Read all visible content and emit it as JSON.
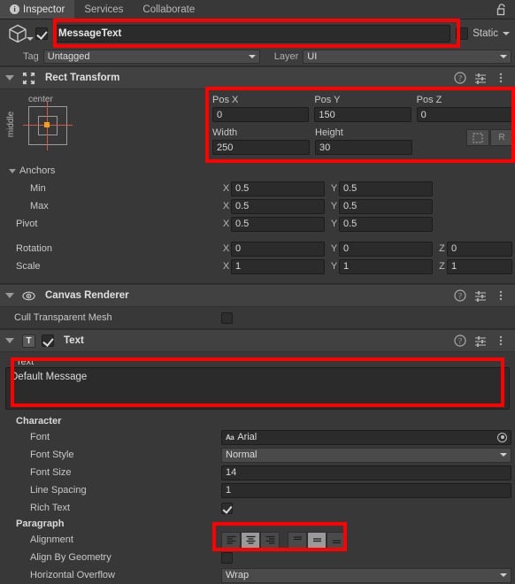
{
  "window": {
    "tabs": [
      {
        "label": "Inspector",
        "icon": "info-icon",
        "active": true
      },
      {
        "label": "Services",
        "icon": null,
        "active": false
      },
      {
        "label": "Collaborate",
        "icon": null,
        "active": false
      }
    ],
    "lock_icon": "lock-open-icon"
  },
  "gameobject": {
    "icon": "cube-icon",
    "enabled": true,
    "name": "MessageText",
    "static_label": "Static",
    "static_enabled": false,
    "tag_label": "Tag",
    "tag_value": "Untagged",
    "layer_label": "Layer",
    "layer_value": "UI"
  },
  "rect_transform": {
    "title": "Rect Transform",
    "icon": "rect-transform-icon",
    "anchor_preset": {
      "horizontal": "center",
      "vertical": "middle"
    },
    "pos_x_label": "Pos X",
    "pos_x": "0",
    "pos_y_label": "Pos Y",
    "pos_y": "150",
    "pos_z_label": "Pos Z",
    "pos_z": "0",
    "width_label": "Width",
    "width": "250",
    "height_label": "Height",
    "height": "30",
    "blueprint_icon": "blueprint-mode-icon",
    "raw_label": "R",
    "anchors_label": "Anchors",
    "min_label": "Min",
    "min_x": "0.5",
    "min_y": "0.5",
    "max_label": "Max",
    "max_x": "0.5",
    "max_y": "0.5",
    "pivot_label": "Pivot",
    "pivot_x": "0.5",
    "pivot_y": "0.5",
    "rotation_label": "Rotation",
    "rotation_x": "0",
    "rotation_y": "0",
    "rotation_z": "0",
    "scale_label": "Scale",
    "scale_x": "1",
    "scale_y": "1",
    "scale_z": "1",
    "axis_x": "X",
    "axis_y": "Y",
    "axis_z": "Z"
  },
  "canvas_renderer": {
    "title": "Canvas Renderer",
    "icon": "eye-icon",
    "cull_label": "Cull Transparent Mesh",
    "cull_enabled": false
  },
  "text_component": {
    "title": "Text",
    "icon": "text-component-icon",
    "enabled": true,
    "text_label": "Text",
    "text_value": "Default Message",
    "character_label": "Character",
    "font_label": "Font",
    "font_value": "Arial",
    "font_style_label": "Font Style",
    "font_style_value": "Normal",
    "font_size_label": "Font Size",
    "font_size_value": "14",
    "line_spacing_label": "Line Spacing",
    "line_spacing_value": "1",
    "rich_text_label": "Rich Text",
    "rich_text_enabled": true,
    "paragraph_label": "Paragraph",
    "alignment_label": "Alignment",
    "alignment_horizontal": "center",
    "alignment_vertical": "middle",
    "align_by_geometry_label": "Align By Geometry",
    "align_by_geometry_enabled": false,
    "horizontal_overflow_label": "Horizontal Overflow",
    "horizontal_overflow_value": "Wrap"
  },
  "header_icons": {
    "help": "help-icon",
    "preset": "preset-icon",
    "menu": "kebab-menu-icon"
  },
  "annotations": {
    "color": "#ff0000",
    "boxes": [
      {
        "name": "name-field-highlight"
      },
      {
        "name": "rect-transform-fields-highlight"
      },
      {
        "name": "text-content-highlight"
      },
      {
        "name": "alignment-buttons-highlight"
      }
    ]
  }
}
